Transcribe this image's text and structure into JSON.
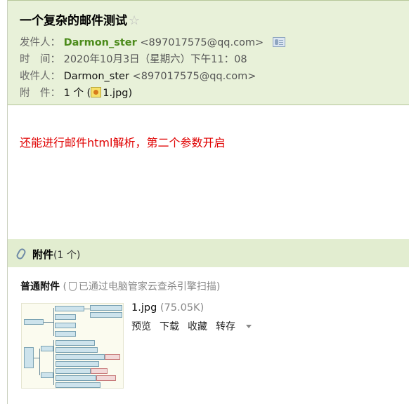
{
  "email": {
    "subject": "一个复杂的邮件测试",
    "star_glyph": "☆",
    "from_label": "发件人：",
    "from_name": "Darmon_ster",
    "from_address": "<897017575@qq.com>",
    "time_label": "时　间：",
    "time_value": "2020年10月3日（星期六）下午11：08",
    "to_label": "收件人：",
    "to_name": "Darmon_ster",
    "to_address": "<897017575@qq.com>",
    "attach_label": "附　件：",
    "attach_count": "1 个 (",
    "attach_file": "1.jpg",
    "attach_close": ")"
  },
  "body": {
    "text": "还能进行邮件html解析，第二个参数开启"
  },
  "attachments": {
    "section_title": "附件",
    "section_count": "(1 个)",
    "normal_label": "普通附件",
    "scan_open": "(",
    "scan_text": "已通过电脑管家云查杀引擎扫描)",
    "file_name": "1.jpg",
    "file_size": "(75.05K)",
    "actions": {
      "preview": "预览",
      "download": "下载",
      "favorite": "收藏",
      "forward": "转存"
    }
  },
  "colors": {
    "header_bg": "#e8f1d9",
    "sender_green": "#4c8b1b",
    "body_red": "#e00000",
    "attach_bar_bg": "#e2edd0"
  },
  "icons": {
    "star": "star-outline-icon",
    "vcard": "contact-card-icon",
    "image": "image-thumbnail-icon",
    "clip": "paperclip-icon",
    "shield": "shield-icon",
    "caret": "chevron-down-icon"
  }
}
